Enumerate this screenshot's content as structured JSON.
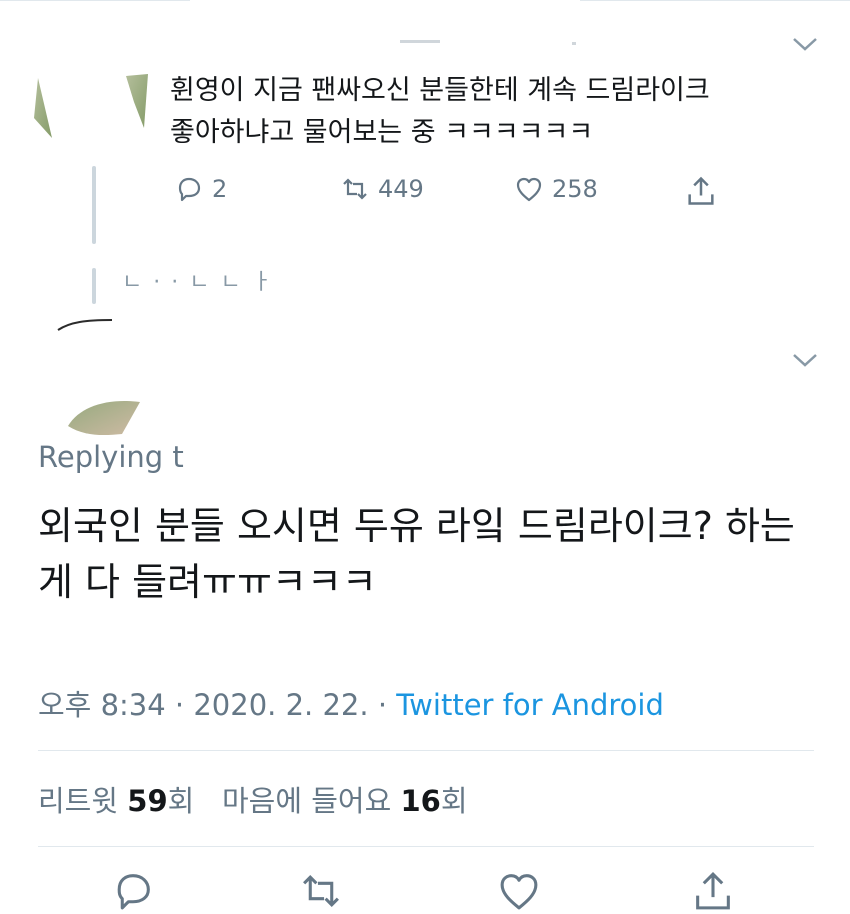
{
  "tweet1": {
    "text_line1": "휜영이 지금 팬싸오신 분들한테 계속 드림라이크",
    "text_line2": "좋아하냐고 물어보는 중 ㅋㅋㅋㅋㅋㅋ",
    "reply_count": "2",
    "retweet_count": "449",
    "like_count": "258",
    "ghost_row": "ㄴ         ·      ·  ㄴ ㄴ ㅏ"
  },
  "tweet2": {
    "replying_to": "Replying t",
    "text": "외국인 분들 오시면 두유 라잌 드림라이크? 하는 게 다 들려ㅠㅠㅋㅋㅋ",
    "time": "오후 8:34 · 2020. 2. 22. · ",
    "source": "Twitter for Android",
    "retweets_label": "리트윗",
    "retweets_value": "59",
    "retweets_unit": "회",
    "likes_label": "마음에 들어요",
    "likes_value": "16",
    "likes_unit": "회"
  },
  "colors": {
    "text": "#14171a",
    "muted": "#657786",
    "link": "#1b95e0",
    "divider": "#e1e8ed"
  },
  "icons": [
    "chevron-down-icon",
    "reply-icon",
    "retweet-icon",
    "like-icon",
    "share-icon"
  ]
}
